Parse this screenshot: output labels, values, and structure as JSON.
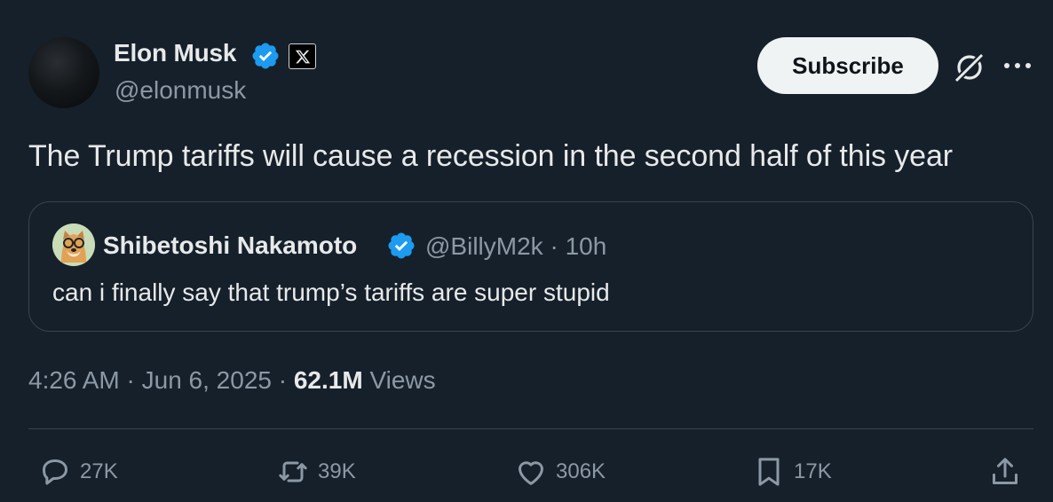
{
  "author": {
    "name": "Elon Musk",
    "handle": "@elonmusk",
    "verified_icon": "verified-badge-icon",
    "affiliate_icon": "x-logo-icon"
  },
  "header": {
    "subscribe_label": "Subscribe",
    "grok_icon": "grok-icon",
    "more_icon": "more-icon"
  },
  "tweet": {
    "text": "The Trump tariffs will cause a recession in the second half of this year"
  },
  "quote": {
    "name": "Shibetoshi Nakamoto",
    "handle": "@BillyM2k",
    "separator": "·",
    "time": "10h",
    "text": "can i finally say that trump’s tariffs are super stupid"
  },
  "meta": {
    "time": "4:26 AM",
    "sep1": "·",
    "date": "Jun 6, 2025",
    "sep2": "·",
    "views_count": "62.1M",
    "views_label": "Views"
  },
  "actions": {
    "replies": "27K",
    "reposts": "39K",
    "likes": "306K",
    "bookmarks": "17K"
  },
  "colors": {
    "background": "#16202a",
    "text_primary": "#e7e9ea",
    "text_secondary": "#8b98a5",
    "verified_blue": "#1d9bf0",
    "border": "#38444d"
  }
}
